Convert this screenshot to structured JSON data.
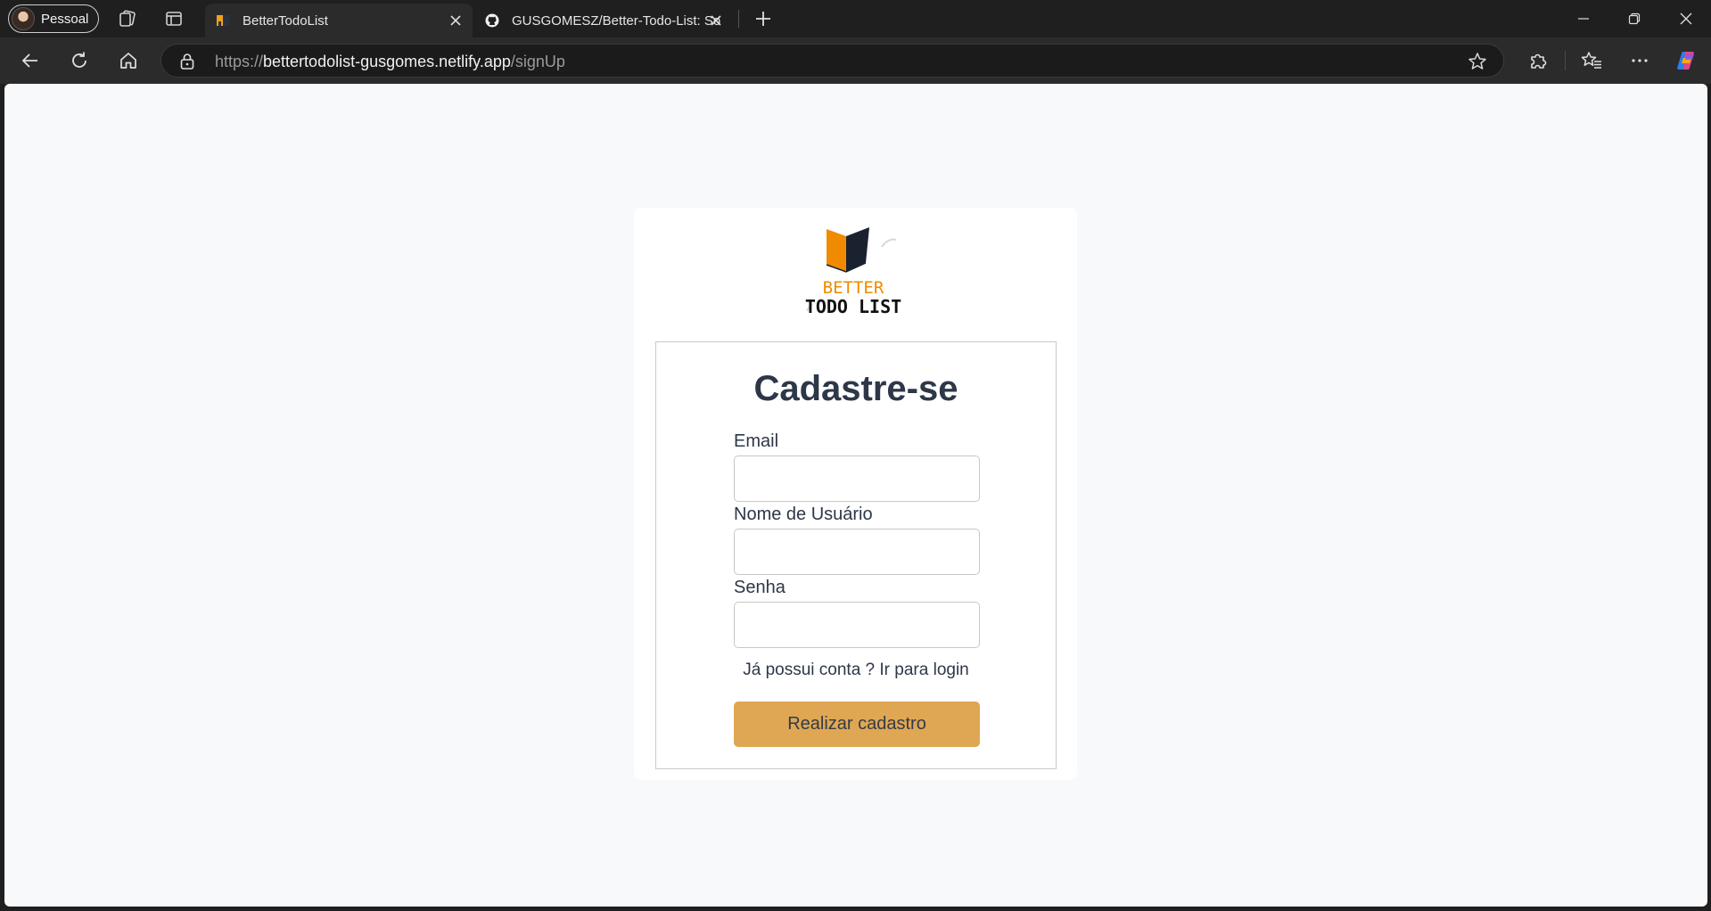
{
  "browser": {
    "profile_label": "Pessoal",
    "tabs": [
      {
        "title": "BetterTodoList"
      },
      {
        "title": "GUSGOMESZ/Better-Todo-List: So"
      }
    ],
    "url": {
      "scheme": "https://",
      "host": "bettertodolist-gusgomes.netlify.app",
      "path": "/signUp"
    }
  },
  "logo": {
    "line1": "BETTER",
    "line2": "TODO LIST",
    "colors": {
      "orange": "#f08a00",
      "dark": "#1a2230"
    }
  },
  "form": {
    "title": "Cadastre-se",
    "fields": [
      {
        "label": "Email",
        "value": ""
      },
      {
        "label": "Nome de Usuário",
        "value": ""
      },
      {
        "label": "Senha",
        "value": ""
      }
    ],
    "login_link": "Já possui conta ? Ir para login",
    "submit_label": "Realizar cadastro"
  },
  "colors": {
    "button": "#dfa753",
    "text": "#2d3748",
    "page_bg": "#f8f9fa"
  }
}
